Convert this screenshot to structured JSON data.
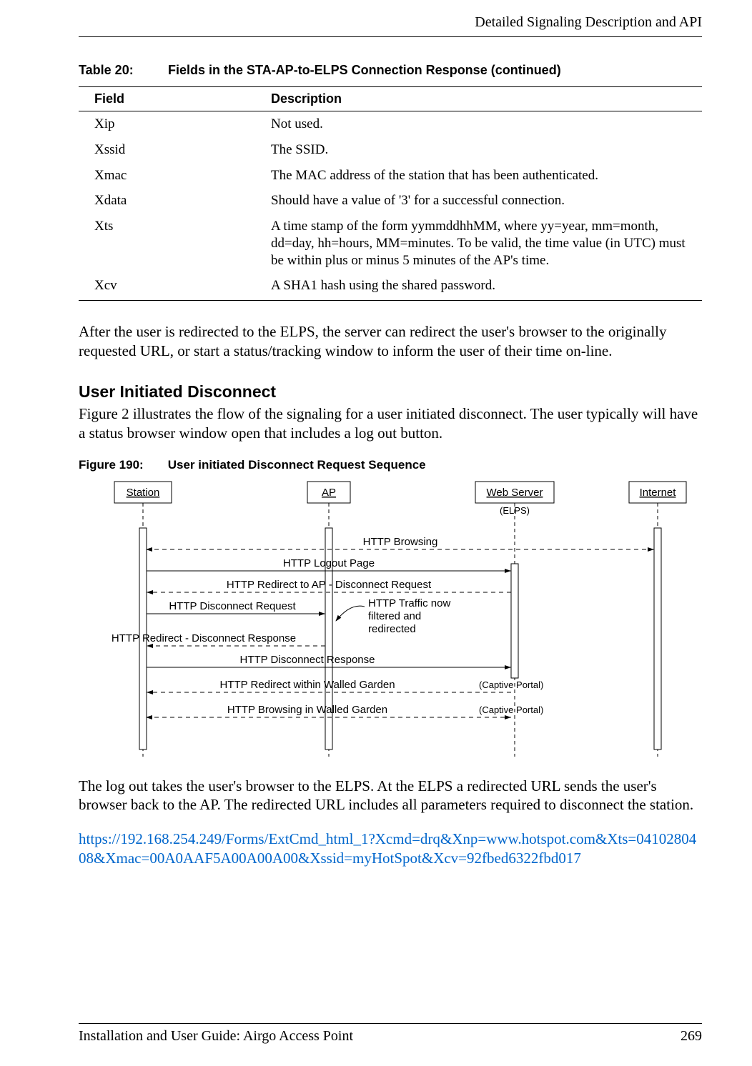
{
  "running_head": "Detailed Signaling Description and API",
  "table": {
    "number": "Table 20:",
    "title": "Fields in the STA-AP-to-ELPS Connection Response (continued)",
    "headers": {
      "field": "Field",
      "desc": "Description"
    },
    "rows": [
      {
        "field": "Xip",
        "desc": "Not used."
      },
      {
        "field": "Xssid",
        "desc": "The SSID."
      },
      {
        "field": "Xmac",
        "desc": "The MAC address of the station that has been authenticated."
      },
      {
        "field": "Xdata",
        "desc": "Should have a value of '3' for a successful connection."
      },
      {
        "field": "Xts",
        "desc": "A time stamp of the form yymmddhhMM, where yy=year, mm=month, dd=day, hh=hours, MM=minutes. To be valid, the time value (in UTC) must be within plus or minus 5 minutes of the AP's time."
      },
      {
        "field": "Xcv",
        "desc": "A SHA1 hash using the shared password."
      }
    ]
  },
  "para1": "After the user is redirected to the ELPS, the server can redirect the user's browser to the originally requested URL, or start a status/tracking window to inform the user of their time on-line.",
  "section_title": "User Initiated Disconnect",
  "para2": "Figure 2 illustrates the flow of the signaling for a user initiated disconnect. The user typically will have a status browser window open that includes a log out button.",
  "figure": {
    "number": "Figure 190:",
    "title": "User initiated Disconnect Request Sequence",
    "actors": {
      "station": "Station",
      "ap": "AP",
      "webserver": "Web Server",
      "internet": "Internet"
    },
    "labels": {
      "elps": "(ELPS)",
      "http_browsing": "HTTP Browsing",
      "logout_page": "HTTP Logout Page",
      "redirect_ap": "HTTP Redirect to AP  - Disconnect Request",
      "disc_request": "HTTP Disconnect Request",
      "traffic_line1": "HTTP Traffic now",
      "traffic_line2": "filtered and",
      "traffic_line3": "redirected",
      "redirect_resp": "HTTP Redirect -  Disconnect Response",
      "disc_response": "HTTP Disconnect Response",
      "redirect_wg": "HTTP Redirect within Walled Garden",
      "browse_wg": "HTTP Browsing  in Walled Garden",
      "captive1": "(Captive Portal)",
      "captive2": "(Captive Portal)"
    }
  },
  "para3": "The log out takes the user's browser to the ELPS. At the ELPS a redirected URL sends the user's browser back to the AP. The redirected URL includes all parameters required to disconnect the station.",
  "url": "https://192.168.254.249/Forms/ExtCmd_html_1?Xcmd=drq&Xnp=www.hotspot.com&Xts=0410280408&Xmac=00A0AAF5A00A00A00&Xssid=myHotSpot&Xcv=92fbed6322fbd017",
  "footer": {
    "left": "Installation and User Guide: Airgo Access Point",
    "page": "269"
  }
}
